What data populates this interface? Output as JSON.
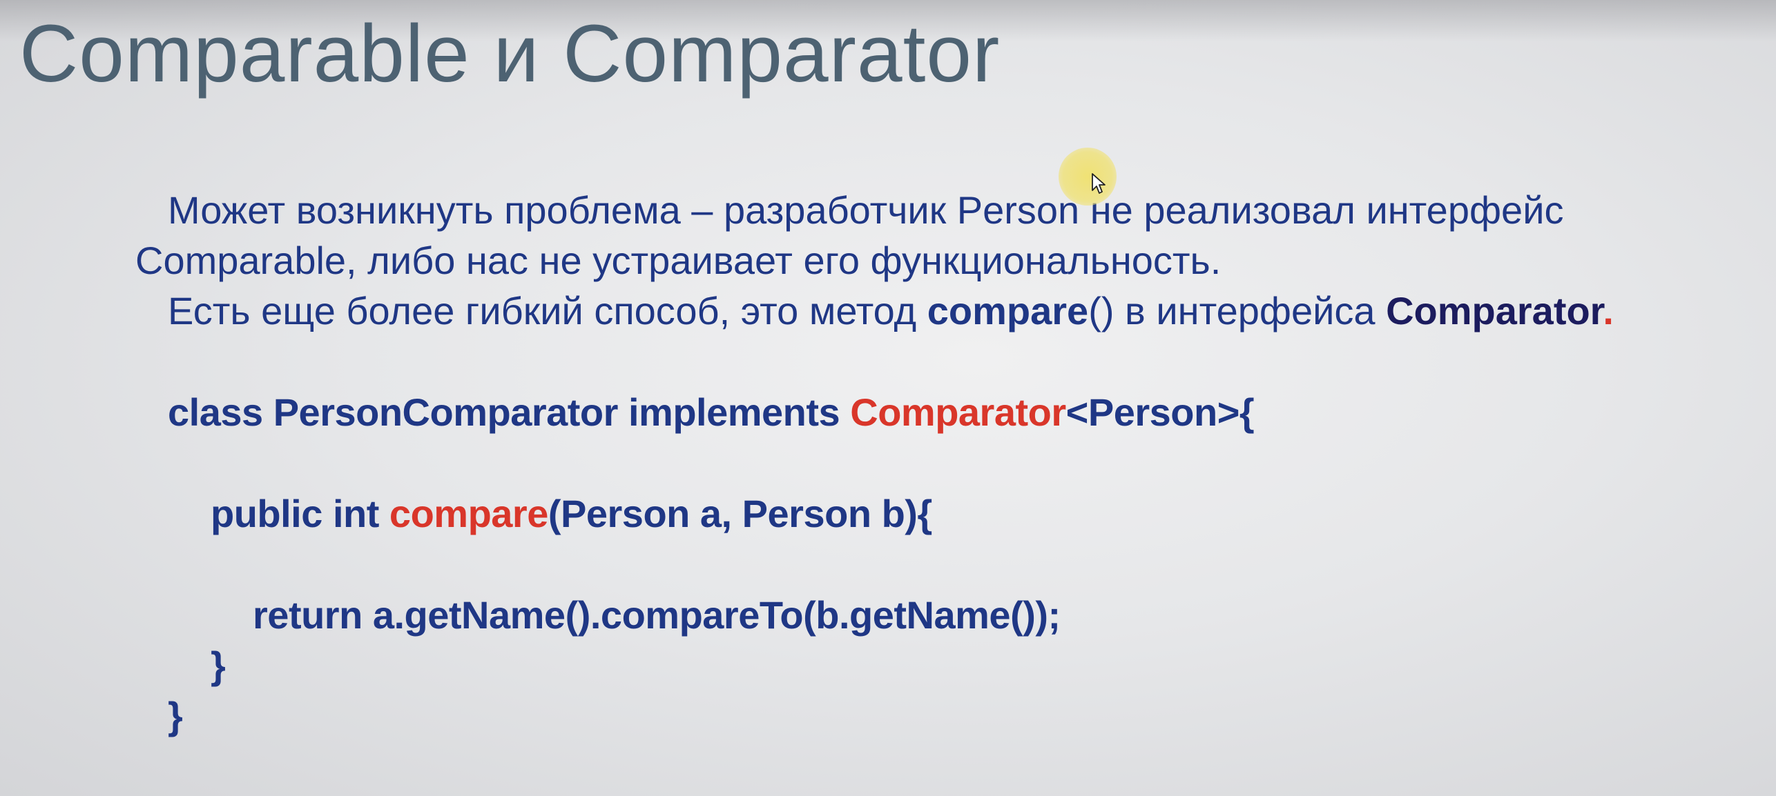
{
  "slide": {
    "title": "Comparable и Comparator",
    "paragraph1": {
      "line1": "Может возникнуть проблема – разработчик Person не реализовал интерфейс",
      "line2": "Comparable, либо нас не устраивает его функциональность."
    },
    "paragraph2": {
      "text_before": "Есть еще более гибкий способ, это метод ",
      "method": "compare",
      "parens": "()",
      "text_middle": " в интерфейса ",
      "interface": "Comparator",
      "dot": "."
    },
    "code": {
      "line1_a": "class PersonComparator implements ",
      "line1_b": "Comparator",
      "line1_c": "<Person>{",
      "line2_a": "public int ",
      "line2_b": "compare",
      "line2_c": "(Person a, Person b){",
      "line3": "return a.getName().compareTo(b.getName());",
      "line4": "}",
      "line5": "}"
    }
  },
  "colors": {
    "title": "#4d6272",
    "text": "#1f3785",
    "keyword_red": "#d9362a",
    "dark_bold": "#1c1c5e"
  },
  "cursor": {
    "icon": "mouse-pointer-icon"
  }
}
